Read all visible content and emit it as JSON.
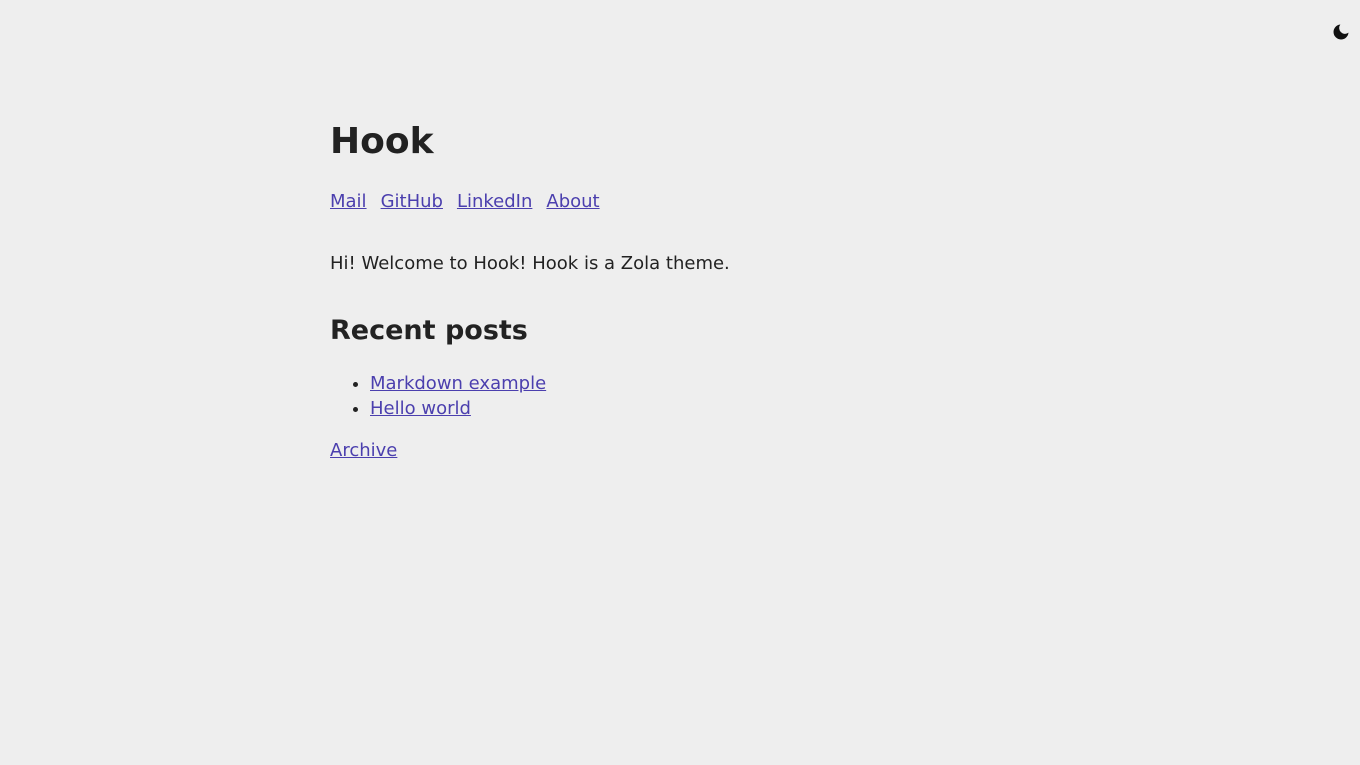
{
  "header": {
    "theme_toggle_icon": "moon-icon"
  },
  "site": {
    "title": "Hook"
  },
  "nav": {
    "links": [
      {
        "label": "Mail"
      },
      {
        "label": "GitHub"
      },
      {
        "label": "LinkedIn"
      },
      {
        "label": "About"
      }
    ]
  },
  "intro": {
    "text": "Hi! Welcome to Hook! Hook is a Zola theme."
  },
  "recent": {
    "heading": "Recent posts",
    "posts": [
      {
        "title": "Markdown example"
      },
      {
        "title": "Hello world"
      }
    ],
    "archive_label": "Archive"
  },
  "colors": {
    "background": "#eeeeee",
    "text": "#222222",
    "link": "#4b3fae"
  }
}
